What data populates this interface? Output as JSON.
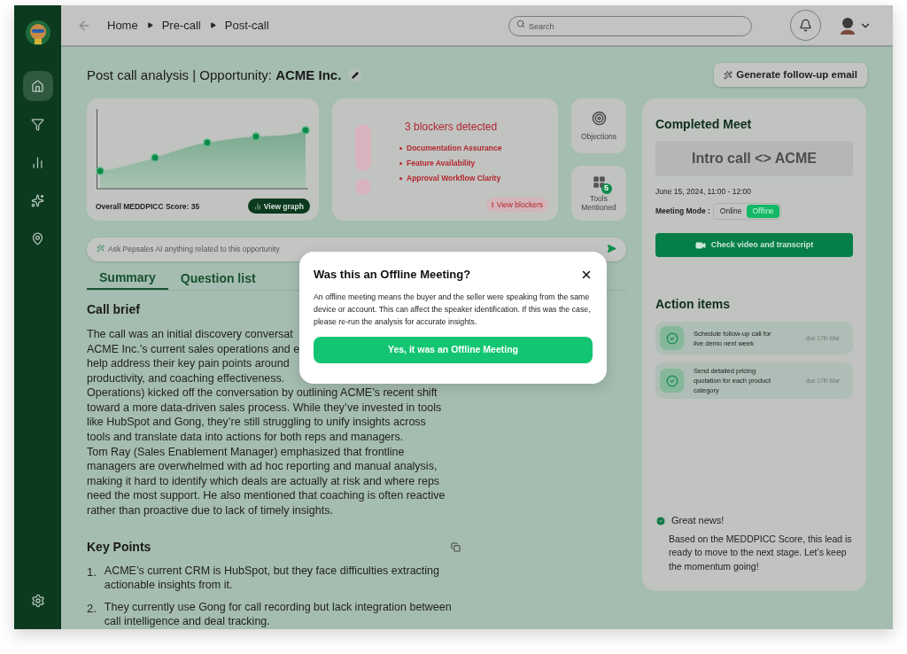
{
  "sidebar": {
    "items": [
      {
        "kind": "home",
        "selected": true
      },
      {
        "kind": "funnel",
        "selected": false
      },
      {
        "kind": "chart",
        "selected": false
      },
      {
        "kind": "sparkle",
        "selected": false
      },
      {
        "kind": "pin",
        "selected": false
      }
    ]
  },
  "breadcrumbs": [
    "Home",
    "Pre-call",
    "Post-call"
  ],
  "search": {
    "placeholder": "Search"
  },
  "page_title": "Post call analysis | Opportunity: **ACME Inc.**",
  "generate_button": "Generate follow-up email",
  "score_card": {
    "label": "Overall MEDDPICC Score: 35",
    "button": "View graph"
  },
  "blockers": {
    "title": "3 blockers detected",
    "items": [
      "Documentation Assurance",
      "Feature Availability",
      "Approval Workflow Clarity"
    ],
    "button": "View blockers",
    "button_mark": "!"
  },
  "tiles": [
    {
      "kind": "objections",
      "label": "Objections"
    },
    {
      "kind": "tools",
      "label": "Tools Mentioned",
      "badge": "5"
    }
  ],
  "ask": {
    "placeholder": "Ask Pepsales AI anything related to this opportunity"
  },
  "tabs": [
    {
      "label": "Summary",
      "selected": true
    },
    {
      "label": "Question list",
      "selected": false
    }
  ],
  "call_brief": {
    "title": "Call brief",
    "lines": [
      "The call was an initial discovery conversat",
      "ACME Inc.’s current sales operations and e",
      "help address their key pain points around",
      "productivity, and coaching effectiveness.",
      "Operations) kicked off the conversation by outlining ACME’s recent shift",
      "toward a more data-driven sales process. While they’ve invested in tools",
      "like HubSpot and Gong, they’re still struggling to unify insights across",
      "tools and translate data into actions for both reps and managers.",
      "Tom Ray (Sales Enablement Manager) emphasized that frontline",
      "managers are overwhelmed with ad hoc reporting and manual analysis,",
      "making it hard to identify which deals are actually at risk and where reps",
      "need the most support. He also mentioned that coaching is often reactive",
      "rather than proactive due to lack of timely insights."
    ]
  },
  "key_points": {
    "title": "Key Points",
    "items": [
      {
        "number": "1.",
        "text": "ACME’s current CRM is HubSpot, but they face difficulties extracting actionable insights from it."
      },
      {
        "number": "2.",
        "text": "They currently use Gong for call recording but lack integration between call intelligence and deal tracking."
      }
    ]
  },
  "meet": {
    "title": "Completed Meet",
    "name": "Intro call <> ACME",
    "time": "June 15, 2024, 11:00 - 12:00",
    "mode_label": "Meeting Mode :",
    "modes": [
      {
        "label": "Online",
        "selected": false
      },
      {
        "label": "Offline",
        "selected": true
      }
    ],
    "button": "Check video and transcript"
  },
  "action_items": {
    "title": "Action items",
    "items": [
      {
        "text": "Schedule follow-up call for live demo next week",
        "due": "due 17th Mar"
      },
      {
        "text": "Send detailed pricing quotation for each product category",
        "due": "due 17th Mar"
      }
    ]
  },
  "news": {
    "title": "Great news!",
    "text": "Based on the MEDDPICC Score, this lead is ready to move to the next stage. Let’s keep the momentum going!"
  },
  "dialog": {
    "title": "Was this an Offline Meeting?",
    "text": "An offline meeting means the buyer and the seller were speaking from the same device or account. This can affect the speaker identification. If this was the case, please re-run the analysis for accurate insights.",
    "button": "Yes, it was an Offline Meeting"
  }
}
